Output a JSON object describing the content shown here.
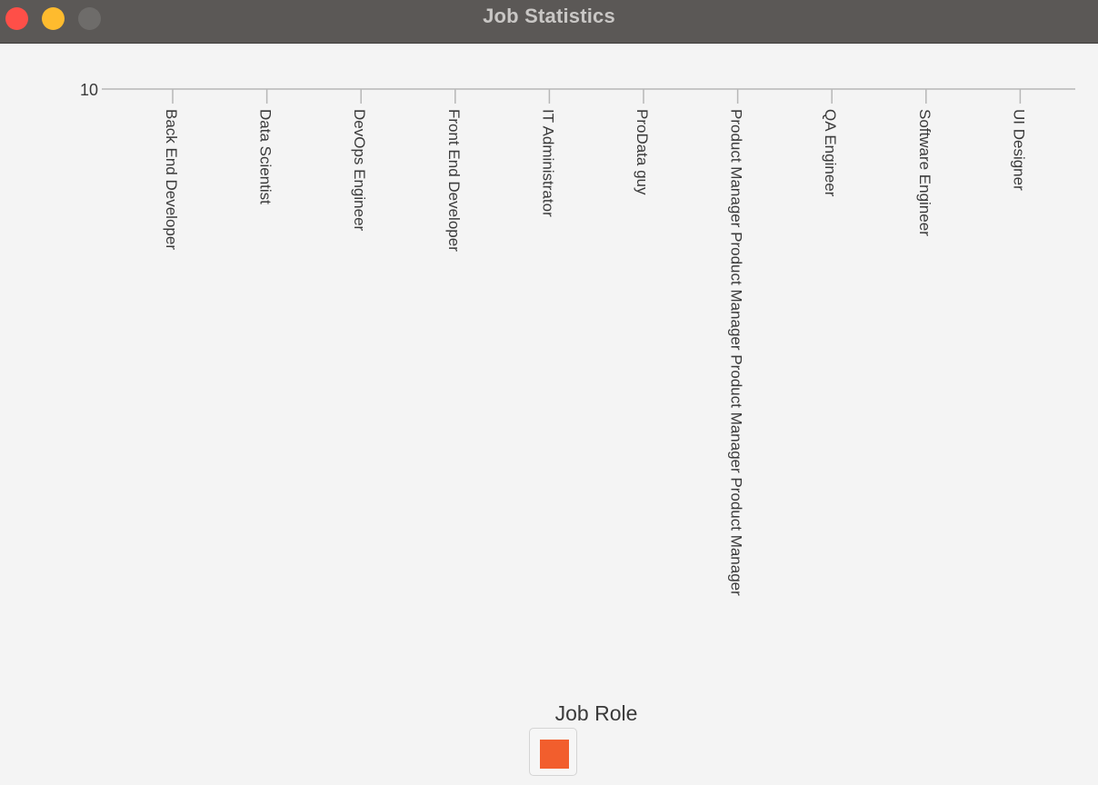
{
  "window": {
    "title": "Job Statistics"
  },
  "colors": {
    "titlebar": "#5b5856",
    "close": "#fe4f48",
    "minimize": "#febb2e",
    "zoom": "#6e6c6a",
    "series": "#f25e2d",
    "axis": "#b7b7b7",
    "text": "#3a3a3a"
  },
  "chart_data": {
    "type": "bar",
    "title": "",
    "xlabel": "",
    "ylabel": "",
    "y_ticks": [
      10
    ],
    "categories": [
      "Back End Developer",
      "Data Scientist",
      "DevOps Engineer",
      "Front End Developer",
      "IT Administrator",
      "ProData guy",
      "Product Manager Product Manager Product Manager Product Manager",
      "QA Engineer",
      "Software Engineer",
      "UI Designer"
    ],
    "series": [
      {
        "name": "Job Role",
        "color": "#f25e2d"
      }
    ],
    "legend": "bottom"
  }
}
